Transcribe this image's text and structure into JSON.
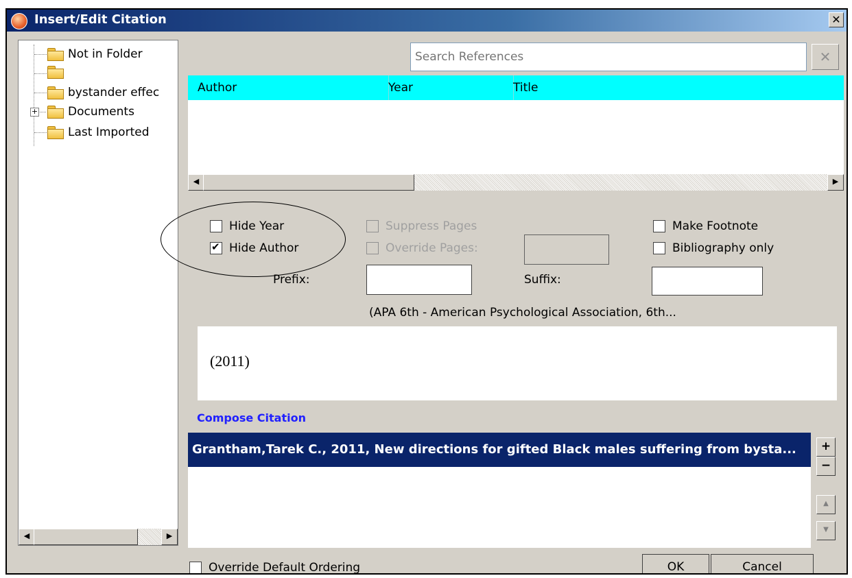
{
  "window": {
    "title": "Insert/Edit Citation",
    "close_glyph": "✕"
  },
  "tree": {
    "items": [
      {
        "label": "Not in Folder"
      },
      {
        "label": ""
      },
      {
        "label": "bystander effec"
      },
      {
        "label": "Documents",
        "expander": "+"
      },
      {
        "label": "Last Imported"
      }
    ]
  },
  "search": {
    "placeholder": "Search References",
    "clear_glyph": "✕"
  },
  "results": {
    "columns": [
      "Author",
      "Year",
      "Title"
    ],
    "header_color": "#00ffff"
  },
  "options": {
    "hide_year": "Hide Year",
    "hide_author": "Hide Author",
    "suppress_pages": "Suppress Pages",
    "override_pages": "Override Pages:",
    "make_footnote": "Make Footnote",
    "bibliography_only": "Bibliography only",
    "prefix": "Prefix:",
    "suffix": "Suffix:",
    "hide_year_checked": false,
    "hide_author_checked": true
  },
  "style_name": "(APA 6th - American Psychological Association, 6th...",
  "preview": {
    "text": "(2011)"
  },
  "compose": {
    "label": "Compose Citation",
    "label_color": "#2020ff",
    "selected_row": "Grantham,Tarek C., 2011, New directions for gifted Black males suffering from bysta...",
    "add_glyph": "+",
    "remove_glyph": "−",
    "up_glyph": "▲",
    "down_glyph": "▼"
  },
  "footer": {
    "override_ordering": "Override Default Ordering",
    "ok": "OK",
    "cancel": "Cancel"
  }
}
